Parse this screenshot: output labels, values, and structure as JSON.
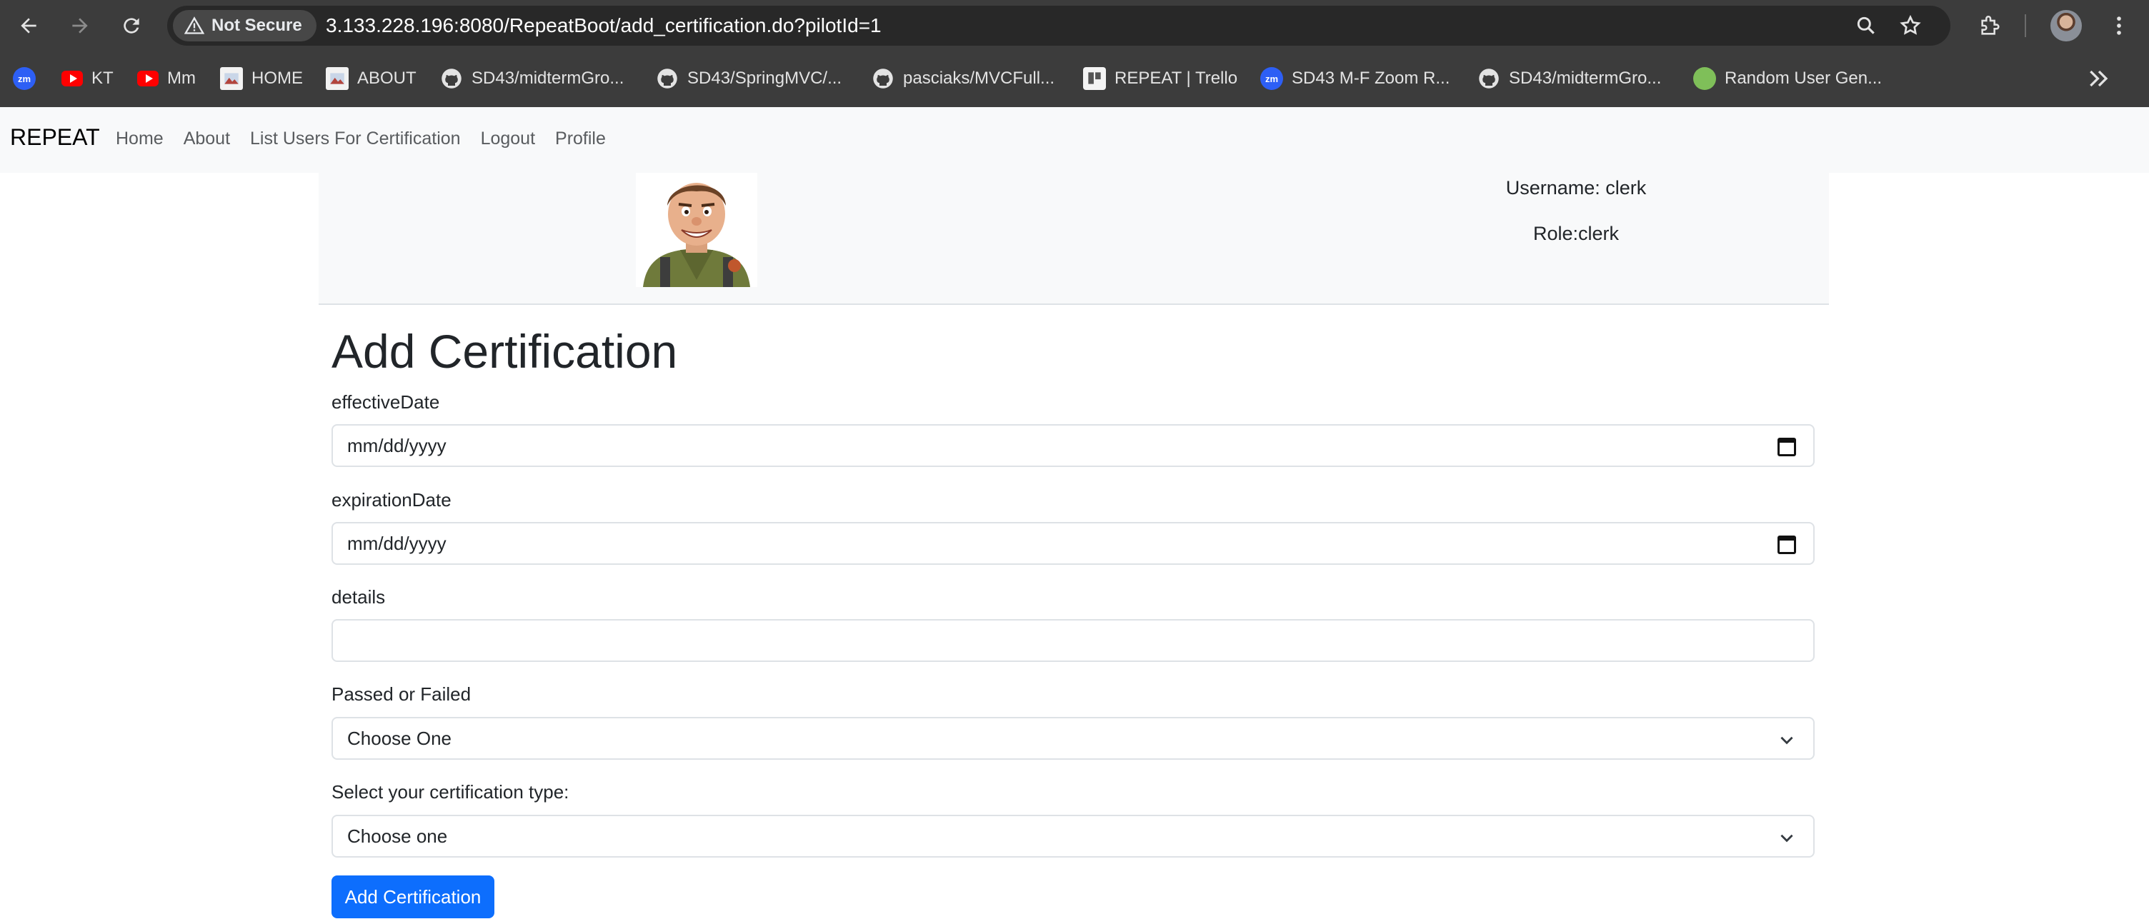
{
  "browser": {
    "security_label": "Not Secure",
    "url": "3.133.228.196:8080/RepeatBoot/add_certification.do?pilotId=1",
    "bookmarks": [
      {
        "label": "",
        "icon": "zoom-icon"
      },
      {
        "label": "KT",
        "icon": "youtube-icon"
      },
      {
        "label": "Mm",
        "icon": "youtube-icon"
      },
      {
        "label": "HOME",
        "icon": "site-icon"
      },
      {
        "label": "ABOUT",
        "icon": "site-icon"
      },
      {
        "label": "SD43/midtermGro...",
        "icon": "github-icon"
      },
      {
        "label": "SD43/SpringMVC/...",
        "icon": "github-icon"
      },
      {
        "label": "pasciaks/MVCFull...",
        "icon": "github-icon"
      },
      {
        "label": "REPEAT | Trello",
        "icon": "trello-icon"
      },
      {
        "label": "SD43 M-F Zoom R...",
        "icon": "zoom-icon"
      },
      {
        "label": "SD43/midtermGro...",
        "icon": "github-icon"
      },
      {
        "label": "Random User Gen...",
        "icon": "random-user-icon"
      }
    ],
    "zoom_badge": "zm"
  },
  "navbar": {
    "brand": "REPEAT",
    "links": [
      "Home",
      "About",
      "List Users For Certification",
      "Logout",
      "Profile"
    ]
  },
  "profile": {
    "username_text": "Username: clerk",
    "role_text": "Role:clerk"
  },
  "form": {
    "title": "Add Certification",
    "effective_date": {
      "label": "effectiveDate",
      "placeholder": "mm/dd/yyyy"
    },
    "expiration_date": {
      "label": "expirationDate",
      "placeholder": "mm/dd/yyyy"
    },
    "details": {
      "label": "details",
      "value": ""
    },
    "result": {
      "label": "Passed or Failed",
      "selected": "Choose One"
    },
    "cert_type": {
      "label": "Select your certification type:",
      "selected": "Choose one"
    },
    "submit_label": "Add Certification"
  },
  "colors": {
    "primary": "#0d6efd",
    "navbar_bg": "#f8f9fa",
    "chrome_bg": "#3c3c3c"
  }
}
